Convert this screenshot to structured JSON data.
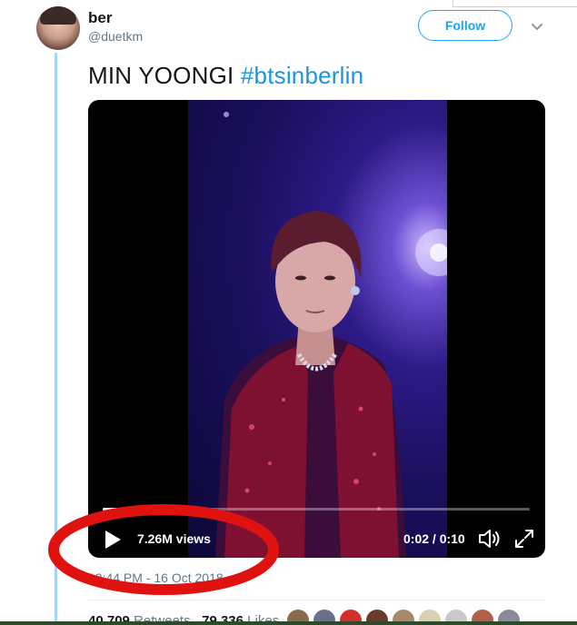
{
  "tweet": {
    "author": {
      "display_name": "ber",
      "handle": "@duetkm"
    },
    "follow_label": "Follow",
    "text": {
      "plain": "MIN YOONGI",
      "hashtag": "#btsinberlin"
    },
    "timestamp": "12:44 PM - 16 Oct 2018",
    "stats": {
      "retweets_count": "40,709",
      "retweets_label": "Retweets",
      "likes_count": "79,336",
      "likes_label": "Likes"
    }
  },
  "video": {
    "views": "7.26M views",
    "time": "0:02 / 0:10",
    "progress": 0.2
  },
  "colors": {
    "accent": "#1da1f2",
    "hashtag": "#1b95e0",
    "annotation": "#e0120f",
    "thread_line": "#a6d4f2"
  },
  "icons": [
    "play-icon",
    "volume-icon",
    "fullscreen-icon",
    "chevron-down-icon"
  ]
}
